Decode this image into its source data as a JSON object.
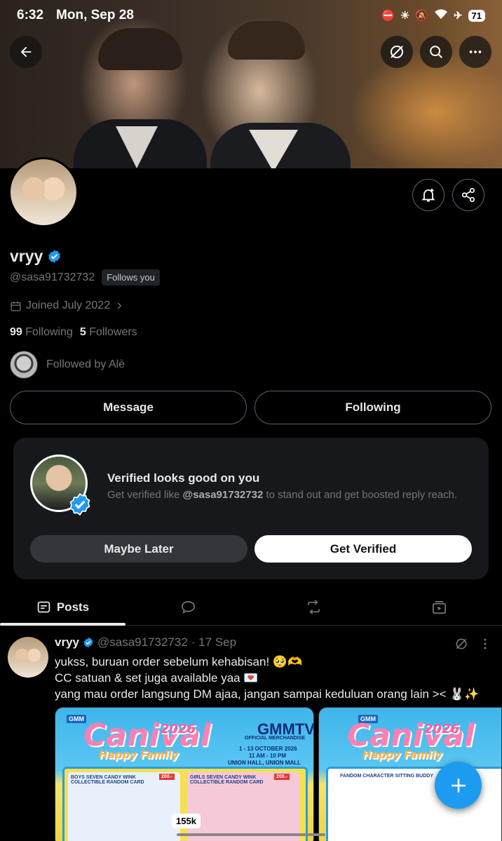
{
  "status_bar": {
    "time": "6:32",
    "date": "Mon, Sep 28",
    "battery": "71"
  },
  "profile": {
    "name": "vryy",
    "handle": "@sasa91732732",
    "follows_you": "Follows you",
    "joined": "Joined July 2022",
    "following_count": "99",
    "following_label": "Following",
    "followers_count": "5",
    "followers_label": "Followers",
    "followed_by": "Followed by Alè"
  },
  "actions": {
    "message": "Message",
    "following": "Following"
  },
  "verified_card": {
    "title": "Verified looks good on you",
    "desc_prefix": "Get verified like ",
    "desc_handle": "@sasa91732732",
    "desc_suffix": " to stand out and get boosted reply reach.",
    "maybe_later": "Maybe Later",
    "get_verified": "Get Verified"
  },
  "tabs": {
    "posts": "Posts"
  },
  "post": {
    "name": "vryy",
    "handle": "@sasa91732732",
    "date": "· 17 Sep",
    "line1": "yukss, buruan order sebelum kehabisan! 🥺🫶",
    "line2": "CC satuan & set juga available yaa 💌",
    "line3": "yang mau order langsung DM ajaa, jangan sampai keduluan orang lain >< 🐰✨",
    "media_count": "155k",
    "media1_brand": "GMMTV",
    "media1_sub": "OFFICIAL MERCHANDISE",
    "media1_dates": "1 - 13 OCTOBER 2026",
    "media1_time": "11 AM - 10 PM",
    "media1_venue": "UNION HALL, UNION MALL",
    "media1_logo": "Canival",
    "media1_year": "2026",
    "media1_tagline": "Happy Family",
    "media1_card1": "BOYS SEVEN CANDY WINK COLLECTIBLE RANDOM CARD",
    "media1_card2": "GIRLS SEVEN CANDY WINK COLLECTIBLE RANDOM CARD",
    "media1_price": "200.-",
    "media2_title": "FANDOM CHARACTER SITTING BUDDY"
  },
  "colors": {
    "accent": "#1d9bf0",
    "background": "#000000",
    "text": "#e7e9ea",
    "muted": "#71767b"
  }
}
